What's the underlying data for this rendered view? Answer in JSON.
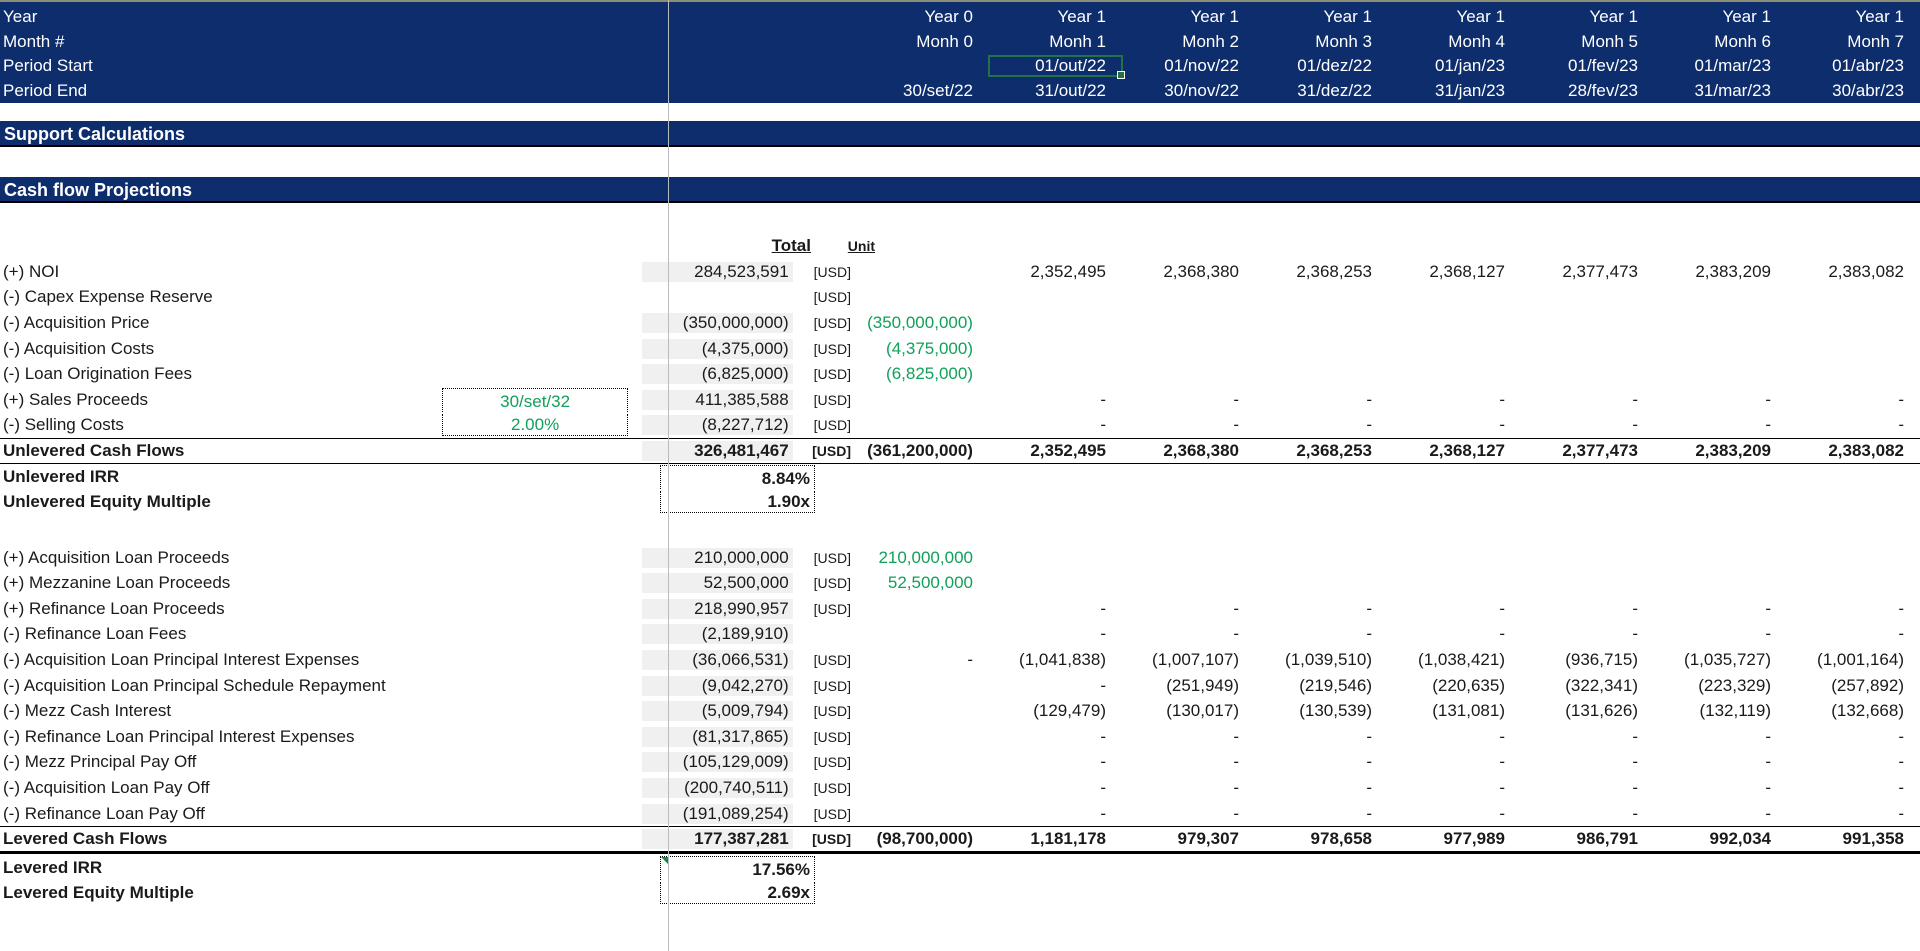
{
  "timeline": {
    "row_labels": [
      "Year",
      "Month #",
      "Period Start",
      "Period End"
    ],
    "year": [
      "Year 0",
      "Year 1",
      "Year 1",
      "Year 1",
      "Year 1",
      "Year 1",
      "Year 1",
      "Year 1"
    ],
    "month": [
      "Monh 0",
      "Monh 1",
      "Monh 2",
      "Monh 3",
      "Monh 4",
      "Monh 5",
      "Monh 6",
      "Monh 7"
    ],
    "period_start": [
      "",
      "01/out/22",
      "01/nov/22",
      "01/dez/22",
      "01/jan/23",
      "01/fev/23",
      "01/mar/23",
      "01/abr/23"
    ],
    "period_end": [
      "30/set/22",
      "31/out/22",
      "30/nov/22",
      "31/dez/22",
      "31/jan/23",
      "28/fev/23",
      "31/mar/23",
      "30/abr/23"
    ],
    "selected_cell_value": "01/out/22"
  },
  "sections": {
    "support": "Support Calculations",
    "cashflow": "Cash flow Projections"
  },
  "column_headers": {
    "total": "Total",
    "unit": "Unit"
  },
  "colors": {
    "header_navy": "#0d2d6c",
    "input_green": "#11a05a",
    "selection_green": "#217346",
    "total_shade": "#f0f0f0"
  },
  "chart_data": {
    "type": "table",
    "title": "Cash flow Projections",
    "categories": [
      "Year 0 / Monh 0",
      "Year 1 / Monh 1",
      "Year 1 / Monh 2",
      "Year 1 / Monh 3",
      "Year 1 / Monh 4",
      "Year 1 / Monh 5",
      "Year 1 / Monh 6",
      "Year 1 / Monh 7"
    ],
    "series": [
      {
        "name": "Unlevered Cash Flows",
        "values": [
          -361200000,
          2352495,
          2368380,
          2368253,
          2368127,
          2377473,
          2383209,
          2383082
        ]
      },
      {
        "name": "Levered Cash Flows",
        "values": [
          -98700000,
          1181178,
          979307,
          978658,
          977989,
          986791,
          992034,
          991358
        ]
      }
    ],
    "totals": {
      "unlevered": 326481467,
      "levered": 177387281
    },
    "metrics": {
      "unlevered_irr": "8.84%",
      "unlevered_equity_multiple": "1.90x",
      "levered_irr": "17.56%",
      "levered_equity_multiple": "2.69x"
    }
  },
  "unlevered_rows": [
    {
      "label": "(+) NOI",
      "total": "284,523,591",
      "unit": "[USD]",
      "cells": [
        "",
        "2,352,495",
        "2,368,380",
        "2,368,253",
        "2,368,127",
        "2,377,473",
        "2,383,209",
        "2,383,082"
      ],
      "green": false
    },
    {
      "label": "(-) Capex Expense Reserve",
      "total": "",
      "unit": "[USD]",
      "cells": [
        "",
        "",
        "",
        "",
        "",
        "",
        "",
        ""
      ],
      "green": false
    },
    {
      "label": "(-) Acquisition Price",
      "total": "(350,000,000)",
      "unit": "[USD]",
      "cells": [
        "(350,000,000)",
        "",
        "",
        "",
        "",
        "",
        "",
        ""
      ],
      "green": true
    },
    {
      "label": "(-) Acquisition Costs",
      "total": "(4,375,000)",
      "unit": "[USD]",
      "cells": [
        "(4,375,000)",
        "",
        "",
        "",
        "",
        "",
        "",
        ""
      ],
      "green": true
    },
    {
      "label": "(-) Loan Origination Fees",
      "total": "(6,825,000)",
      "unit": "[USD]",
      "cells": [
        "(6,825,000)",
        "",
        "",
        "",
        "",
        "",
        "",
        ""
      ],
      "green": true
    },
    {
      "label": "(+) Sales Proceeds",
      "total": "411,385,588",
      "unit": "[USD]",
      "cells": [
        "",
        "-",
        "-",
        "-",
        "-",
        "-",
        "-",
        "-"
      ],
      "green": false,
      "input": "30/set/32"
    },
    {
      "label": "(-) Selling Costs",
      "total": "(8,227,712)",
      "unit": "[USD]",
      "cells": [
        "",
        "-",
        "-",
        "-",
        "-",
        "-",
        "-",
        "-"
      ],
      "green": false,
      "input": "2.00%"
    }
  ],
  "unlevered_total_row": {
    "label": "Unlevered Cash Flows",
    "total": "326,481,467",
    "unit": "[USD]",
    "cells": [
      "(361,200,000)",
      "2,352,495",
      "2,368,380",
      "2,368,253",
      "2,368,127",
      "2,377,473",
      "2,383,209",
      "2,383,082"
    ]
  },
  "unlevered_metrics": [
    {
      "label": "Unlevered IRR",
      "value": "8.84%"
    },
    {
      "label": "Unlevered Equity Multiple",
      "value": "1.90x"
    }
  ],
  "levered_rows": [
    {
      "label": "(+) Acquisition Loan Proceeds",
      "total": "210,000,000",
      "unit": "[USD]",
      "cells": [
        "210,000,000",
        "",
        "",
        "",
        "",
        "",
        "",
        ""
      ],
      "green": true
    },
    {
      "label": "(+) Mezzanine Loan Proceeds",
      "total": "52,500,000",
      "unit": "[USD]",
      "cells": [
        "52,500,000",
        "",
        "",
        "",
        "",
        "",
        "",
        ""
      ],
      "green": true
    },
    {
      "label": "(+) Refinance Loan Proceeds",
      "total": "218,990,957",
      "unit": "[USD]",
      "cells": [
        "",
        "-",
        "-",
        "-",
        "-",
        "-",
        "-",
        "-"
      ],
      "green": false
    },
    {
      "label": "(-) Refinance Loan Fees",
      "total": "(2,189,910)",
      "unit": "",
      "cells": [
        "",
        "-",
        "-",
        "-",
        "-",
        "-",
        "-",
        "-"
      ],
      "green": false
    },
    {
      "label": "(-) Acquisition Loan Principal Interest Expenses",
      "total": "(36,066,531)",
      "unit": "[USD]",
      "cells": [
        "-",
        "(1,041,838)",
        "(1,007,107)",
        "(1,039,510)",
        "(1,038,421)",
        "(936,715)",
        "(1,035,727)",
        "(1,001,164)"
      ],
      "green": false
    },
    {
      "label": "(-) Acquisition Loan Principal Schedule Repayment",
      "total": "(9,042,270)",
      "unit": "[USD]",
      "cells": [
        "",
        "-",
        "(251,949)",
        "(219,546)",
        "(220,635)",
        "(322,341)",
        "(223,329)",
        "(257,892)"
      ],
      "green": false
    },
    {
      "label": "(-) Mezz Cash Interest",
      "total": "(5,009,794)",
      "unit": "[USD]",
      "cells": [
        "",
        "(129,479)",
        "(130,017)",
        "(130,539)",
        "(131,081)",
        "(131,626)",
        "(132,119)",
        "(132,668)"
      ],
      "green": false
    },
    {
      "label": "(-) Refinance Loan Principal Interest Expenses",
      "total": "(81,317,865)",
      "unit": "[USD]",
      "cells": [
        "",
        "-",
        "-",
        "-",
        "-",
        "-",
        "-",
        "-"
      ],
      "green": false
    },
    {
      "label": "(-) Mezz Principal Pay Off",
      "total": "(105,129,009)",
      "unit": "[USD]",
      "cells": [
        "",
        "-",
        "-",
        "-",
        "-",
        "-",
        "-",
        "-"
      ],
      "green": false
    },
    {
      "label": "(-) Acquisition Loan Pay Off",
      "total": "(200,740,511)",
      "unit": "[USD]",
      "cells": [
        "",
        "-",
        "-",
        "-",
        "-",
        "-",
        "-",
        "-"
      ],
      "green": false
    },
    {
      "label": "(-) Refinance Loan Pay Off",
      "total": "(191,089,254)",
      "unit": "[USD]",
      "cells": [
        "",
        "-",
        "-",
        "-",
        "-",
        "-",
        "-",
        "-"
      ],
      "green": false
    }
  ],
  "levered_total_row": {
    "label": "Levered Cash Flows",
    "total": "177,387,281",
    "unit": "[USD]",
    "cells": [
      "(98,700,000)",
      "1,181,178",
      "979,307",
      "978,658",
      "977,989",
      "986,791",
      "992,034",
      "991,358"
    ]
  },
  "levered_metrics": [
    {
      "label": "Levered IRR",
      "value": "17.56%"
    },
    {
      "label": "Levered Equity Multiple",
      "value": "2.69x"
    }
  ]
}
